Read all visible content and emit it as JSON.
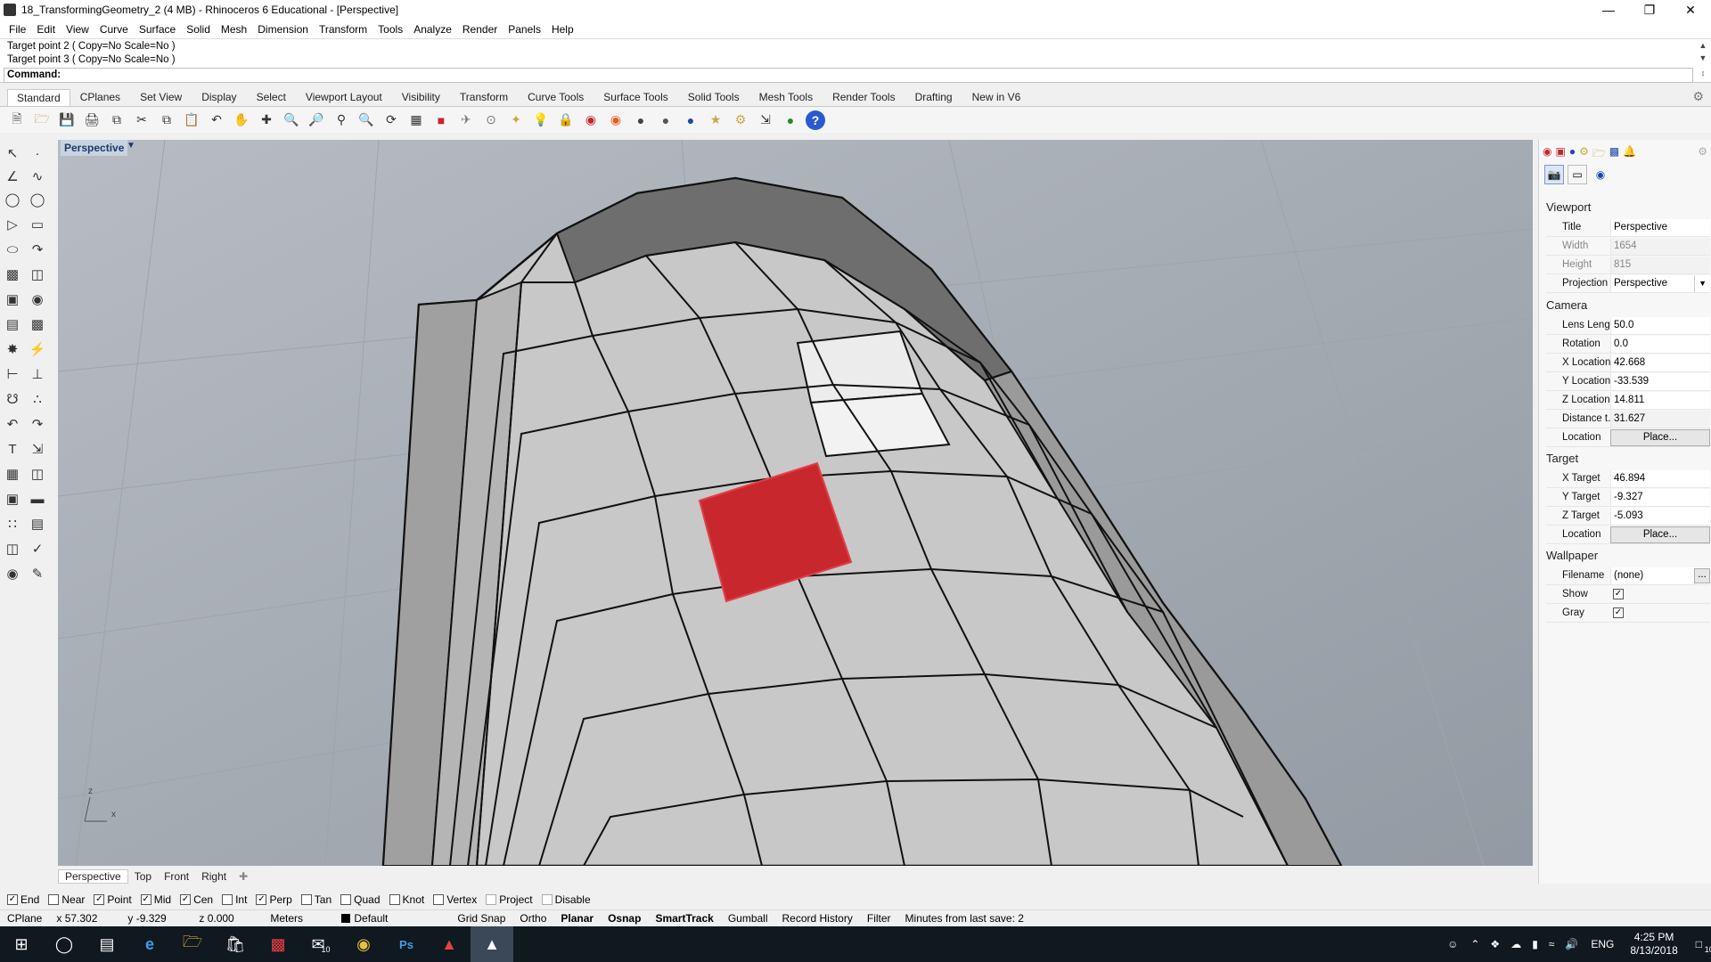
{
  "window": {
    "title": "18_TransformingGeometry_2 (4 MB) - Rhinoceros 6 Educational - [Perspective]"
  },
  "menu": [
    "File",
    "Edit",
    "View",
    "Curve",
    "Surface",
    "Solid",
    "Mesh",
    "Dimension",
    "Transform",
    "Tools",
    "Analyze",
    "Render",
    "Panels",
    "Help"
  ],
  "command": {
    "history": [
      "Target point 2 ( Copy=No  Scale=No )",
      "Target point 3 ( Copy=No  Scale=No )"
    ],
    "prompt": "Command:"
  },
  "toolbar_tabs": [
    "Standard",
    "CPlanes",
    "Set View",
    "Display",
    "Select",
    "Viewport Layout",
    "Visibility",
    "Transform",
    "Curve Tools",
    "Surface Tools",
    "Solid Tools",
    "Mesh Tools",
    "Render Tools",
    "Drafting",
    "New in V6"
  ],
  "viewport": {
    "label": "Perspective",
    "axis_x": "x",
    "axis_z": "z"
  },
  "viewport_tabs": [
    "Perspective",
    "Top",
    "Front",
    "Right"
  ],
  "osnaps": [
    {
      "label": "End",
      "checked": true
    },
    {
      "label": "Near",
      "checked": false
    },
    {
      "label": "Point",
      "checked": true
    },
    {
      "label": "Mid",
      "checked": true
    },
    {
      "label": "Cen",
      "checked": true
    },
    {
      "label": "Int",
      "checked": false
    },
    {
      "label": "Perp",
      "checked": true
    },
    {
      "label": "Tan",
      "checked": false
    },
    {
      "label": "Quad",
      "checked": false
    },
    {
      "label": "Knot",
      "checked": false
    },
    {
      "label": "Vertex",
      "checked": false
    },
    {
      "label": "Project",
      "checked": false
    },
    {
      "label": "Disable",
      "checked": false
    }
  ],
  "status": {
    "cplane": "CPlane",
    "x": "x 57.302",
    "y": "y -9.329",
    "z": "z 0.000",
    "units": "Meters",
    "layer": "Default",
    "grid_snap": "Grid Snap",
    "ortho": "Ortho",
    "planar": "Planar",
    "osnap": "Osnap",
    "smarttrack": "SmartTrack",
    "gumball": "Gumball",
    "record_history": "Record History",
    "filter": "Filter",
    "save_info": "Minutes from last save: 2"
  },
  "panel": {
    "viewport_section": "Viewport",
    "viewport_rows": [
      {
        "k": "Title",
        "v": "Perspective"
      },
      {
        "k": "Width",
        "v": "1654"
      },
      {
        "k": "Height",
        "v": "815"
      },
      {
        "k": "Projection",
        "v": "Perspective"
      }
    ],
    "camera_section": "Camera",
    "camera_rows": [
      {
        "k": "Lens Length",
        "v": "50.0"
      },
      {
        "k": "Rotation",
        "v": "0.0"
      },
      {
        "k": "X Location",
        "v": "42.668"
      },
      {
        "k": "Y Location",
        "v": "-33.539"
      },
      {
        "k": "Z Location",
        "v": "14.811"
      },
      {
        "k": "Distance t...",
        "v": "31.627"
      },
      {
        "k": "Location",
        "v": "Place..."
      }
    ],
    "target_section": "Target",
    "target_rows": [
      {
        "k": "X Target",
        "v": "46.894"
      },
      {
        "k": "Y Target",
        "v": "-9.327"
      },
      {
        "k": "Z Target",
        "v": "-5.093"
      },
      {
        "k": "Location",
        "v": "Place..."
      }
    ],
    "wallpaper_section": "Wallpaper",
    "wallpaper_rows": [
      {
        "k": "Filename",
        "v": "(none)"
      },
      {
        "k": "Show",
        "v": "checked"
      },
      {
        "k": "Gray",
        "v": "checked"
      }
    ],
    "filename_button": "..."
  },
  "taskbar": {
    "time": "4:25 PM",
    "date": "8/13/2018",
    "lang": "ENG",
    "notif_count": "10",
    "mail_badge": "10"
  },
  "colors": {
    "selected_face": "#c8282d",
    "viewport_bg": "#a6adb5",
    "taskbar": "#101820"
  }
}
